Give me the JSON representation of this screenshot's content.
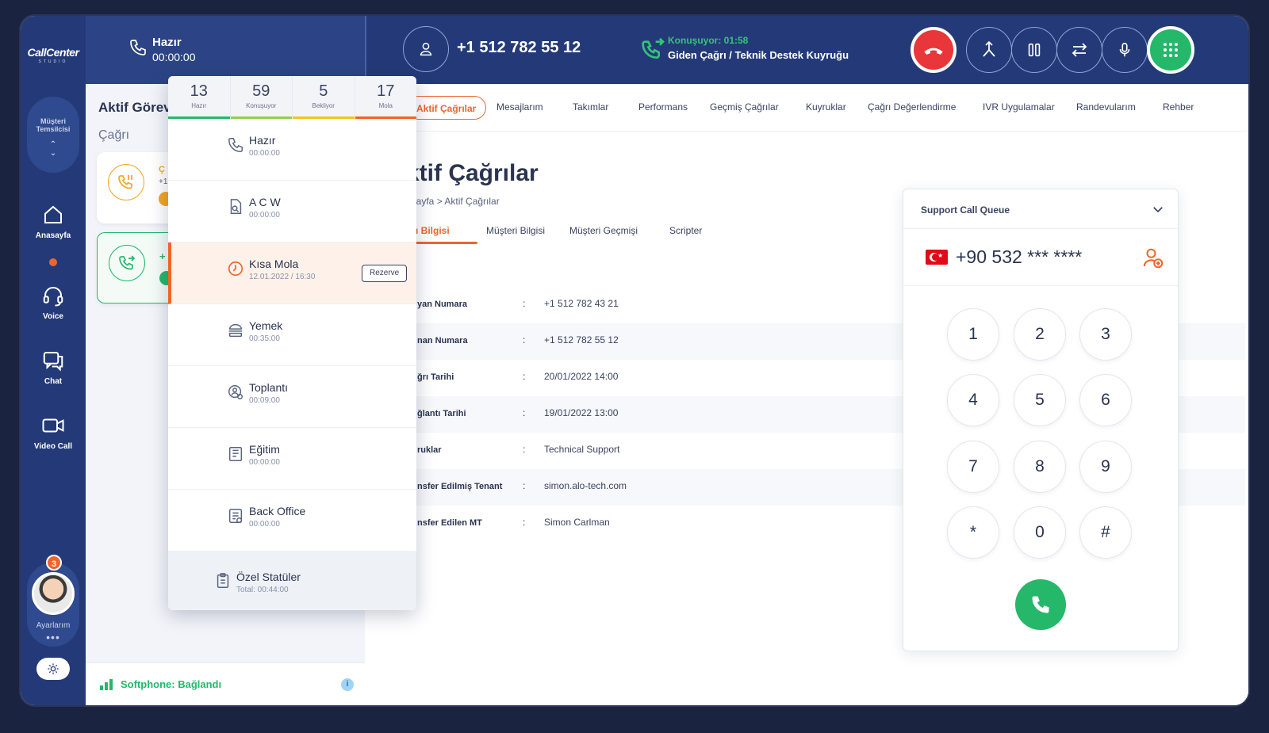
{
  "brand": {
    "name": "CallCenter",
    "tagline": "STUDIO"
  },
  "rail": {
    "role": "Müşteri Temsilcisi",
    "items": [
      {
        "label": "Anasayfa",
        "icon": "home-icon"
      },
      {
        "label": "Voice",
        "icon": "headset-icon"
      },
      {
        "label": "Chat",
        "icon": "chat-icon"
      },
      {
        "label": "Video Call",
        "icon": "video-icon"
      }
    ],
    "notification_count": "3",
    "settings_label": "Ayarlarım",
    "settings_more": "•••"
  },
  "status": {
    "name": "Hazır",
    "time": "00:00:00"
  },
  "call": {
    "number": "+1 512 782 55 12",
    "state": "Konuşuyor: 01:58",
    "description": "Giden Çağrı / Teknik Destek Kuyruğu"
  },
  "sidebar": {
    "title": "Aktif Görev",
    "subtitle": "Çağrı",
    "cards": [
      {
        "title": "Ç",
        "line": "+1"
      },
      {
        "title": "+"
      }
    ],
    "softphone": "Softphone: Bağlandı",
    "info": "i"
  },
  "tabs": [
    {
      "label": "Aktif Çağrılar",
      "active": true
    },
    {
      "label": "Mesajlarım"
    },
    {
      "label": "Takımlar"
    },
    {
      "label": "Performans"
    },
    {
      "label": "Geçmiş  Çağrılar"
    },
    {
      "label": "Kuyruklar"
    },
    {
      "label": "Çağrı Değerlendirme"
    },
    {
      "label": "IVR Uygulamalar"
    },
    {
      "label": "Randevularım"
    },
    {
      "label": "Rehber"
    }
  ],
  "page": {
    "title": "ktif Çağrılar",
    "breadcrumb": "nsayfa  >  Aktif Çağrılar",
    "subtabs": [
      "ğrı Bilgisi",
      "Müşteri Bilgisi",
      "Müşteri Geçmişi",
      "Scripter"
    ]
  },
  "call_info": [
    {
      "key": "yan Numara",
      "value": "+1 512 782 43 21"
    },
    {
      "key": "nan Numara",
      "value": "+1 512 782 55 12"
    },
    {
      "key": "ğrı Tarihi",
      "value": "20/01/2022  14:00"
    },
    {
      "key": "ğlantı Tarihi",
      "value": "19/01/2022  13:00"
    },
    {
      "key": "ruklar",
      "value": "Technical Support"
    },
    {
      "key": "nsfer Edilmiş Tenant",
      "value": "simon.alo-tech.com"
    },
    {
      "key": "nsfer Edilen MT",
      "value": "Simon Carlman"
    }
  ],
  "dialer": {
    "queue": "Support Call Queue",
    "country_flag": "turkey-flag-icon",
    "phone": "+90 532 *** ****",
    "keys": [
      "1",
      "2",
      "3",
      "4",
      "5",
      "6",
      "7",
      "8",
      "9",
      "*",
      "0",
      "#"
    ]
  },
  "status_menu": {
    "stats": [
      {
        "num": "13",
        "label": "Hazır",
        "color": "#25b86a"
      },
      {
        "num": "59",
        "label": "Konuşuyor",
        "color": "#8fd14f"
      },
      {
        "num": "5",
        "label": "Bekliyor",
        "color": "#f5c518"
      },
      {
        "num": "17",
        "label": "Mola",
        "color": "#f0642a"
      }
    ],
    "items": [
      {
        "name": "Hazır",
        "sub": "00:00:00",
        "icon": "phone-icon"
      },
      {
        "name": "A C W",
        "sub": "00:00:00",
        "icon": "document-search-icon"
      },
      {
        "name": "Kısa Mola",
        "sub": "12.01.2022 / 16:30",
        "icon": "clock-icon",
        "action": "Rezerve",
        "selected": true
      },
      {
        "name": "Yemek",
        "sub": "00:35:00",
        "icon": "burger-icon"
      },
      {
        "name": "Toplantı",
        "sub": "00:09:00",
        "icon": "meeting-icon"
      },
      {
        "name": "Eğitim",
        "sub": "00:00:00",
        "icon": "book-icon"
      },
      {
        "name": "Back Office",
        "sub": "00:00:00",
        "icon": "checklist-icon"
      }
    ],
    "footer": {
      "name": "Özel Statüler",
      "sub": "Total: 00:44:00",
      "icon": "clipboard-icon"
    }
  }
}
